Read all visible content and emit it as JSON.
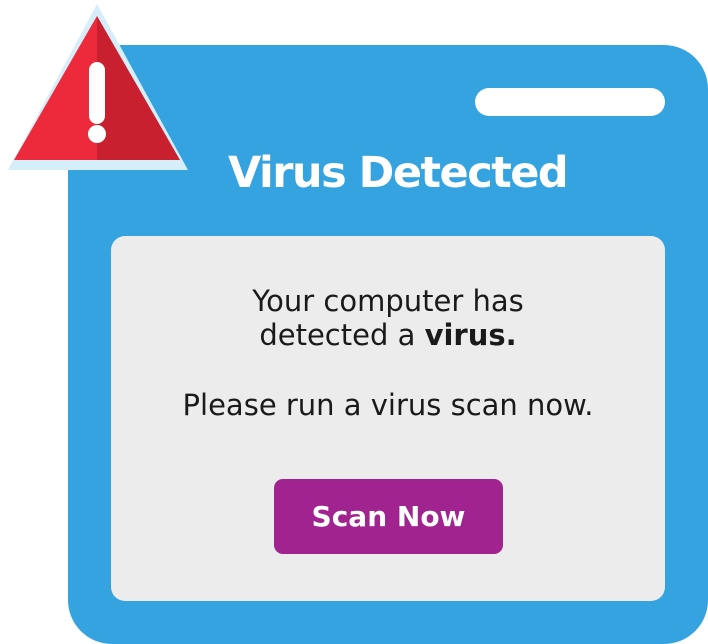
{
  "dialog": {
    "title": "Virus Detected",
    "message_line1": "Your computer has",
    "message_line2_prefix": "detected a ",
    "message_line2_bold": "virus.",
    "message_line3": "Please run a virus scan now.",
    "scan_button_label": "Scan Now"
  },
  "icons": {
    "warning": "warning-triangle-icon"
  },
  "colors": {
    "window_blue": "#34a3e0",
    "panel_gray": "#ececec",
    "button_purple": "#a0238f",
    "warning_red": "#e02a3a"
  }
}
